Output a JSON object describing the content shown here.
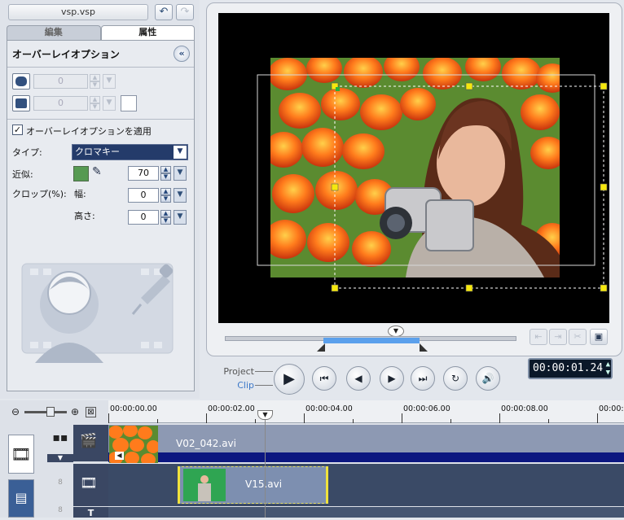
{
  "project": {
    "name": "vsp.vsp",
    "undo_icon": "undo-icon",
    "redo_icon": "redo-icon"
  },
  "tabs": [
    {
      "label": "編集",
      "active": false
    },
    {
      "label": "属性",
      "active": true
    }
  ],
  "overlay": {
    "title": "オーバーレイオプション",
    "mask_value": "0",
    "border_value": "0",
    "apply_label": "オーバーレイオプションを適用",
    "apply_checked": true,
    "type_label": "タイプ:",
    "type_value": "クロマキー",
    "similarity_label": "近似:",
    "similarity_value": "70",
    "key_color": "#569a52",
    "crop_label": "クロップ(%):",
    "width_label": "幅:",
    "width_value": "0",
    "height_label": "高さ:",
    "height_value": "0"
  },
  "preview": {
    "timecode": "00:00:01.24",
    "mode_project": "Project",
    "mode_clip": "Clip",
    "trim_fraction_start": 0.34,
    "trim_fraction_end": 0.67,
    "playhead_fraction": 0.58
  },
  "playback_buttons": [
    "play-icon",
    "home-icon",
    "prev-frame-icon",
    "next-frame-icon",
    "end-icon",
    "repeat-icon",
    "volume-icon"
  ],
  "timeline": {
    "ruler": [
      "00:00:00.00",
      "00:00:02.00",
      "00:00:04.00",
      "00:00:06.00",
      "00:00:08.00",
      "00:00:1"
    ],
    "clips": [
      {
        "name": "V02_042.avi"
      },
      {
        "name": "V15.avi"
      }
    ],
    "track_labels": [
      "8",
      "8"
    ],
    "title_track_icon": "T"
  },
  "colors": {
    "accent": "#5ba0ec",
    "timeline_clip": "#8592ad",
    "overlay_clip_border": "#f0e23c",
    "chroma_green": "#2fa552"
  }
}
